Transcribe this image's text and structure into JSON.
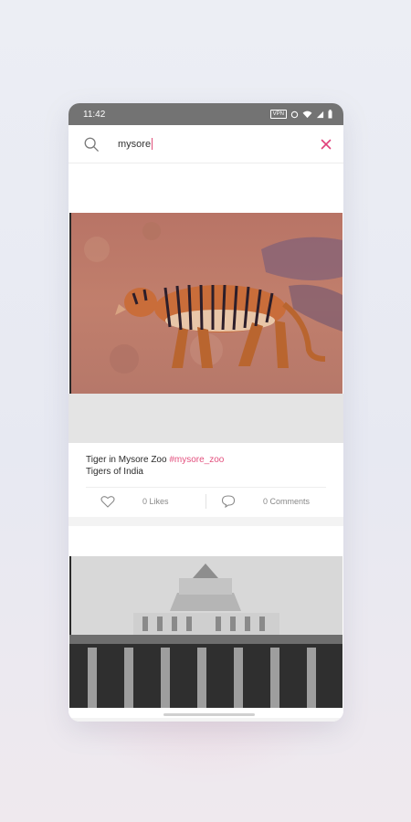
{
  "status": {
    "time": "11:42",
    "vpn": "VPN"
  },
  "search": {
    "query": "mysore"
  },
  "posts": [
    {
      "caption_text": "Tiger in Mysore Zoo ",
      "hashtag": "#mysore_zoo",
      "album": "Tigers of India",
      "likes": "0 Likes",
      "comments": "0 Comments"
    }
  ],
  "colors": {
    "accent": "#e3507e",
    "statusbar": "#737373"
  }
}
